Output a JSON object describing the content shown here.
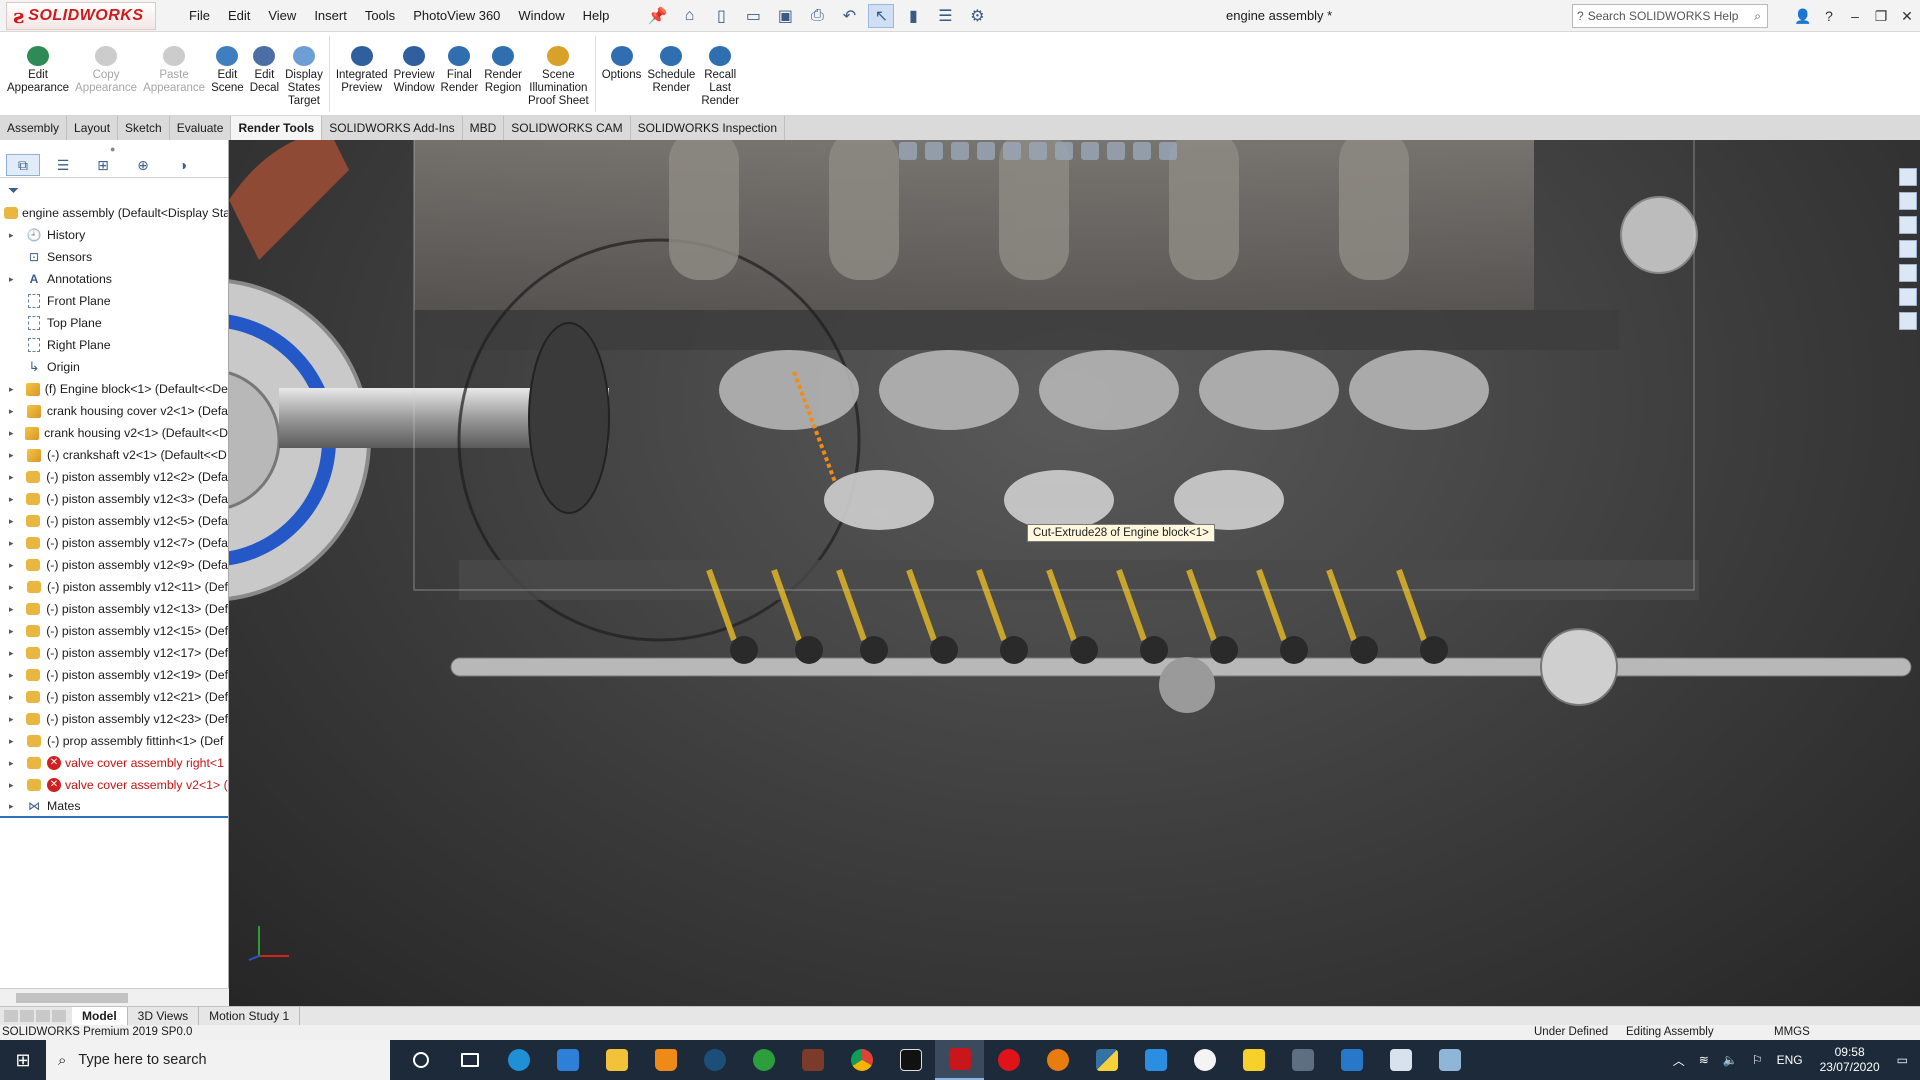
{
  "app": {
    "logo_text": "SOLIDWORKS",
    "document_title": "engine assembly *",
    "help_search_placeholder": "Search SOLIDWORKS Help"
  },
  "menu": [
    "File",
    "Edit",
    "View",
    "Insert",
    "Tools",
    "PhotoView 360",
    "Window",
    "Help"
  ],
  "ribbon": [
    {
      "label": "Edit\nAppearance",
      "l1": "Edit",
      "l2": "Appearance",
      "l3": "",
      "l4": "",
      "enabled": true,
      "color": "#2e8b57"
    },
    {
      "l1": "Copy",
      "l2": "Appearance",
      "l3": "",
      "l4": "",
      "enabled": false,
      "color": "#cccccc"
    },
    {
      "l1": "Paste",
      "l2": "Appearance",
      "l3": "",
      "l4": "",
      "enabled": false,
      "color": "#cccccc"
    },
    {
      "l1": "Edit",
      "l2": "Scene",
      "l3": "",
      "l4": "",
      "enabled": true,
      "color": "#3f7fbf"
    },
    {
      "l1": "Edit",
      "l2": "Decal",
      "l3": "",
      "l4": "",
      "enabled": true,
      "color": "#4a6fa5"
    },
    {
      "l1": "Display",
      "l2": "States",
      "l3": "Target",
      "l4": "",
      "enabled": true,
      "color": "#6d9fd6"
    },
    {
      "l1": "Integrated",
      "l2": "Preview",
      "l3": "",
      "l4": "",
      "enabled": true,
      "color": "#2f5f9f"
    },
    {
      "l1": "Preview",
      "l2": "Window",
      "l3": "",
      "l4": "",
      "enabled": true,
      "color": "#2f5f9f"
    },
    {
      "l1": "Final",
      "l2": "Render",
      "l3": "",
      "l4": "",
      "enabled": true,
      "color": "#2f6fb0"
    },
    {
      "l1": "Render",
      "l2": "Region",
      "l3": "",
      "l4": "",
      "enabled": true,
      "color": "#2f6fb0"
    },
    {
      "l1": "Scene",
      "l2": "Illumination",
      "l3": "Proof Sheet",
      "l4": "",
      "enabled": true,
      "color": "#d9a02a"
    },
    {
      "l1": "Options",
      "l2": "",
      "l3": "",
      "l4": "",
      "enabled": true,
      "color": "#2f6fb0"
    },
    {
      "l1": "Schedule",
      "l2": "Render",
      "l3": "",
      "l4": "",
      "enabled": true,
      "color": "#2f6fb0"
    },
    {
      "l1": "Recall",
      "l2": "Last",
      "l3": "Render",
      "l4": "",
      "enabled": true,
      "color": "#2f6fb0"
    }
  ],
  "command_tabs": [
    "Assembly",
    "Layout",
    "Sketch",
    "Evaluate",
    "Render Tools",
    "SOLIDWORKS Add-Ins",
    "MBD",
    "SOLIDWORKS CAM",
    "SOLIDWORKS Inspection"
  ],
  "active_command_tab": "Render Tools",
  "tree": {
    "root": "engine assembly  (Default<Display Sta",
    "nodes": [
      {
        "label": "History",
        "icon": "history-icon",
        "exp": "▸"
      },
      {
        "label": "Sensors",
        "icon": "sensors-icon",
        "exp": ""
      },
      {
        "label": "Annotations",
        "icon": "annotations-icon",
        "exp": "▸"
      },
      {
        "label": "Front Plane",
        "icon": "plane-icon",
        "exp": ""
      },
      {
        "label": "Top Plane",
        "icon": "plane-icon",
        "exp": ""
      },
      {
        "label": "Right Plane",
        "icon": "plane-icon",
        "exp": ""
      },
      {
        "label": "Origin",
        "icon": "origin-icon",
        "exp": ""
      },
      {
        "label": "(f) Engine block<1> (Default<<De",
        "icon": "part-icon",
        "exp": "▸"
      },
      {
        "label": "crank housing cover v2<1> (Defa",
        "icon": "part-icon",
        "exp": "▸"
      },
      {
        "label": "crank housing v2<1> (Default<<D",
        "icon": "part-icon",
        "exp": "▸"
      },
      {
        "label": "(-) crankshaft v2<1> (Default<<D",
        "icon": "part-icon",
        "exp": "▸"
      },
      {
        "label": "(-) piston assembly v12<2> (Defa",
        "icon": "assembly-icon",
        "exp": "▸"
      },
      {
        "label": "(-) piston assembly v12<3> (Defa",
        "icon": "assembly-icon",
        "exp": "▸"
      },
      {
        "label": "(-) piston assembly v12<5> (Defa",
        "icon": "assembly-icon",
        "exp": "▸"
      },
      {
        "label": "(-) piston assembly v12<7> (Defa",
        "icon": "assembly-icon",
        "exp": "▸"
      },
      {
        "label": "(-) piston assembly v12<9> (Defa",
        "icon": "assembly-icon",
        "exp": "▸"
      },
      {
        "label": "(-) piston assembly v12<11> (Def",
        "icon": "assembly-icon",
        "exp": "▸"
      },
      {
        "label": "(-) piston assembly v12<13> (Def",
        "icon": "assembly-icon",
        "exp": "▸"
      },
      {
        "label": "(-) piston assembly v12<15> (Def",
        "icon": "assembly-icon",
        "exp": "▸"
      },
      {
        "label": "(-) piston assembly v12<17> (Def",
        "icon": "assembly-icon",
        "exp": "▸"
      },
      {
        "label": "(-) piston assembly v12<19> (Def",
        "icon": "assembly-icon",
        "exp": "▸"
      },
      {
        "label": "(-) piston assembly v12<21> (Def",
        "icon": "assembly-icon",
        "exp": "▸"
      },
      {
        "label": "(-) piston assembly v12<23> (Def",
        "icon": "assembly-icon",
        "exp": "▸"
      },
      {
        "label": "(-) prop assembly fittinh<1> (Def",
        "icon": "assembly-icon",
        "exp": "▸"
      }
    ],
    "error_nodes": [
      {
        "label": "valve cover assembly right<1",
        "exp": "▸"
      },
      {
        "label": "valve cover assembly v2<1> (",
        "exp": "▸"
      }
    ],
    "mates": "Mates"
  },
  "viewport": {
    "tooltip": "Cut-Extrude28 of Engine block<1>"
  },
  "bottom_tabs": [
    "Model",
    "3D Views",
    "Motion Study 1"
  ],
  "active_bottom_tab": "Model",
  "status": {
    "product": "SOLIDWORKS Premium 2019 SP0.0",
    "state": "Under Defined",
    "mode": "Editing Assembly",
    "units": "MMGS"
  },
  "taskbar": {
    "search_placeholder": "Type here to search",
    "language": "ENG",
    "time": "09:58",
    "date": "23/07/2020"
  }
}
